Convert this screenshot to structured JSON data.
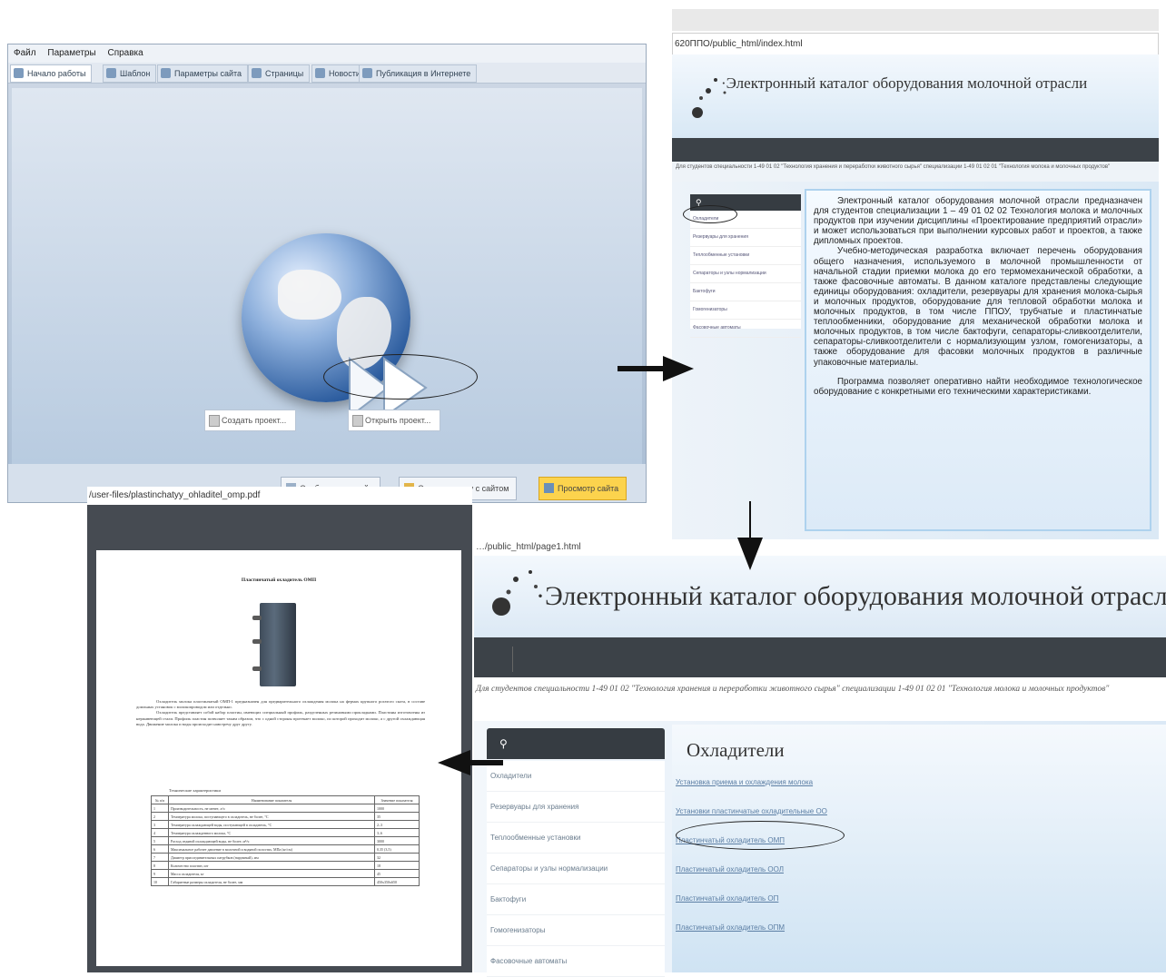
{
  "app": {
    "menu": [
      "Файл",
      "Параметры",
      "Справка"
    ],
    "tabs": [
      {
        "label": "Начало работы",
        "icon": "home-icon",
        "active": true
      },
      {
        "label": "Шаблон",
        "icon": "template-icon"
      },
      {
        "label": "Параметры сайта",
        "icon": "settings-icon"
      },
      {
        "label": "Страницы",
        "icon": "pages-icon"
      },
      {
        "label": "Новости",
        "icon": "news-icon"
      },
      {
        "label": "Публикация в Интернете",
        "icon": "publish-icon"
      }
    ],
    "create_project": "Создать проект...",
    "open_project": "Открыть проект...",
    "bottom_buttons": [
      "Опубликовать сайт",
      "Открыть папку с сайтом",
      "Просмотр сайта"
    ]
  },
  "site_home": {
    "url": "620ППО/public_html/index.html",
    "title": "·Электронный каталог оборудования молочной отрасли",
    "subtitle": "Для студентов специальности 1-49 01 02 \"Технология хранения и переработки животного сырья\" специализации 1-49 01 02 01 \"Технология молока и молочных продуктов\"",
    "sidebar": [
      "Охладители",
      "Резервуары для хранения",
      "Теплообменные установки",
      "Сепараторы и узлы нормализации",
      "Бактофуги",
      "Гомогенизаторы",
      "Фасовочные автоматы"
    ],
    "paragraphs": [
      "Электронный каталог оборудования молочной отрасли предназначен для студентов специализации 1 – 49 01 02 02 Технология молока и молочных продуктов при изучении дисциплины «Проектирование предприятий отрасли» и может использоваться при выполнении курсовых работ и проектов, а также дипломных проектов.",
      "Учебно-методическая разработка включает перечень оборудования общего назначения, используемого в молочной промышленности от начальной стадии приемки молока до его термомеханической обработки, а также фасовочные автоматы. В данном каталоге представлены следующие единицы оборудования: охладители, резервуары для хранения молока-сырья и молочных продуктов, оборудование для тепловой обработки молока и молочных продуктов, в том числе ППОУ, трубчатые и пластинчатые теплообменники, оборудование для механической обработки молока и молочных продуктов, в том числе бактофуги, сепараторы-сливкоотделители, сепараторы-сливкоотделители с нормализующим узлом, гомогенизаторы, а также оборудование для фасовки молочных продуктов в различные упаковочные материалы.",
      "Программа позволяет оперативно найти необходимое технологическое оборудование с конкретными его техническими характеристиками."
    ]
  },
  "site_cat": {
    "url": "…/public_html/page1.html",
    "title": "·Электронный каталог оборудования молочной отрасли",
    "subtitle": "Для студентов специальности 1-49 01 02 \"Технология хранения и переработки животного сырья\" специализации 1-49 01 02 01 \"Технология молока и молочных продуктов\"",
    "sidebar": [
      "Охладители",
      "Резервуары для хранения",
      "Теплообменные установки",
      "Сепараторы и узлы нормализации",
      "Бактофуги",
      "Гомогенизаторы",
      "Фасовочные автоматы"
    ],
    "heading": "Охладители",
    "links": [
      "Установка приема и охлаждения молока",
      "Установки пластинчатые охладительные ОО",
      "Пластинчатый охладитель ОМП",
      "Пластинчатый охладитель ООЛ",
      "Пластинчатый охладитель ОП",
      "Пластинчатый охладитель ОПМ"
    ]
  },
  "pdf": {
    "url": "/user-files/plastinchatyy_ohladitel_omp.pdf",
    "title": "Пластинчатый охладитель ОМП",
    "paragraphs": [
      "Охладитель молока пластинчатый ОМП-1 предназначен для предварительного охлаждения молока на фермах крупного рогатого скота, в составе доильных установок с молокопроводом или отдельно.",
      "Охладитель представляет собой набор пластин, имеющих специальный профиль, разделенных резиновыми прокладками. Пластины изготовлены из нержавеющей стали. Профиль пластин позволяет таким образом, что с одной стороны протекает молоко, по которой проходит молоко, а с другой охлаждающая вода. Движение молока и воды происходит навстречу друг другу."
    ],
    "table_caption": "Технические характеристики",
    "table_headers": [
      "№ п/п",
      "Наименование показателя",
      "Значение показателя"
    ],
    "table_rows": [
      [
        "1",
        "Производительность, не менее, л/ч",
        "1000"
      ],
      [
        "2",
        "Температура молока, поступающего в охладитель, не более, °С",
        "35"
      ],
      [
        "3",
        "Температура охлаждающей воды, поступающей в охладитель, °С",
        "2–3"
      ],
      [
        "4",
        "Температура охлажденного молока, °С",
        "3–6"
      ],
      [
        "5",
        "Расход ледяной охлаждающей воды, не более, м³/ч",
        "3000"
      ],
      [
        "6",
        "Максимальное рабочее давление в молочной и водяной полостях, МПа (кг/см)",
        "0,35 (3,5)"
      ],
      [
        "7",
        "Диаметр присоединительных патрубков (наружный), мм",
        "32"
      ],
      [
        "8",
        "Количество пластин, шт",
        "18"
      ],
      [
        "9",
        "Масса охладителя, кг",
        "45"
      ],
      [
        "10",
        "Габаритные размеры охладителя, не более, мм",
        "450х350х650"
      ]
    ]
  }
}
